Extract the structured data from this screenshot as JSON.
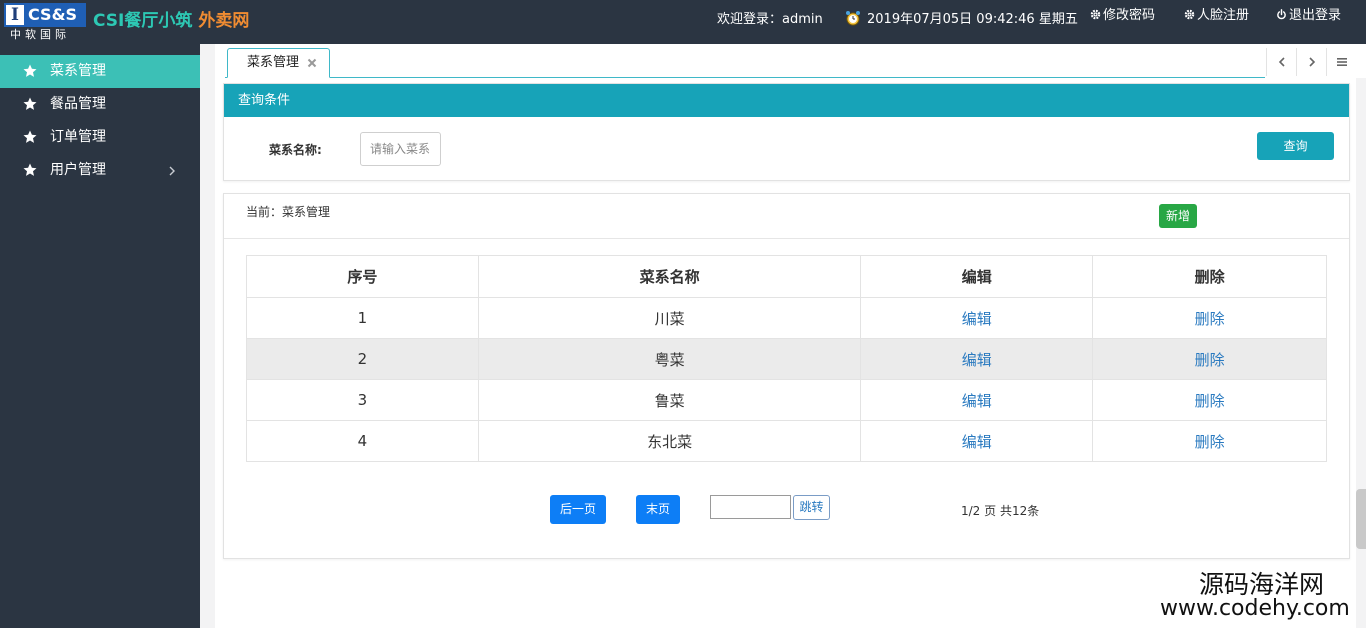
{
  "header": {
    "logo": {
      "letter": "I",
      "text": "CS&S",
      "sub": "中软国际"
    },
    "brand": {
      "part1": "CSI餐厅小筑",
      "part2": "外卖网"
    },
    "welcome": "欢迎登录：admin",
    "datetime": "2019年07月05日 09:42:46 星期五",
    "change_password": "修改密码",
    "face_register": "人脸注册",
    "logout": "退出登录"
  },
  "sidebar": {
    "items": [
      {
        "label": "菜系管理",
        "active": true,
        "icon": "star-icon"
      },
      {
        "label": "餐品管理",
        "active": false,
        "icon": "star-icon"
      },
      {
        "label": "订单管理",
        "active": false,
        "icon": "star-icon"
      },
      {
        "label": "用户管理",
        "active": false,
        "icon": "star-icon",
        "has_children": true
      }
    ]
  },
  "tabs": [
    {
      "label": "菜系管理",
      "active": true
    }
  ],
  "query": {
    "title": "查询条件",
    "field_label": "菜系名称:",
    "placeholder": "请输入菜系",
    "value": "",
    "button": "查询"
  },
  "list": {
    "breadcrumb": "当前：菜系管理",
    "add_button": "新增",
    "columns": [
      "序号",
      "菜系名称",
      "编辑",
      "删除"
    ],
    "rows": [
      {
        "index": "1",
        "name": "川菜",
        "edit": "编辑",
        "delete": "删除"
      },
      {
        "index": "2",
        "name": "粤菜",
        "edit": "编辑",
        "delete": "删除"
      },
      {
        "index": "3",
        "name": "鲁菜",
        "edit": "编辑",
        "delete": "删除"
      },
      {
        "index": "4",
        "name": "东北菜",
        "edit": "编辑",
        "delete": "删除"
      }
    ]
  },
  "pager": {
    "next": "后一页",
    "last": "末页",
    "jump_value": "",
    "jump": "跳转",
    "info": "1/2 页 共12条"
  },
  "watermark": {
    "cn": "源码海洋网",
    "url": "www.codehy.com"
  },
  "colors": {
    "topbar": "#2b3542",
    "sidebar_active": "#3cc0b6",
    "panel_header": "#17a3b8",
    "add_button": "#28a745",
    "pager_button": "#0d7ef6",
    "link": "#2a7ac0"
  }
}
